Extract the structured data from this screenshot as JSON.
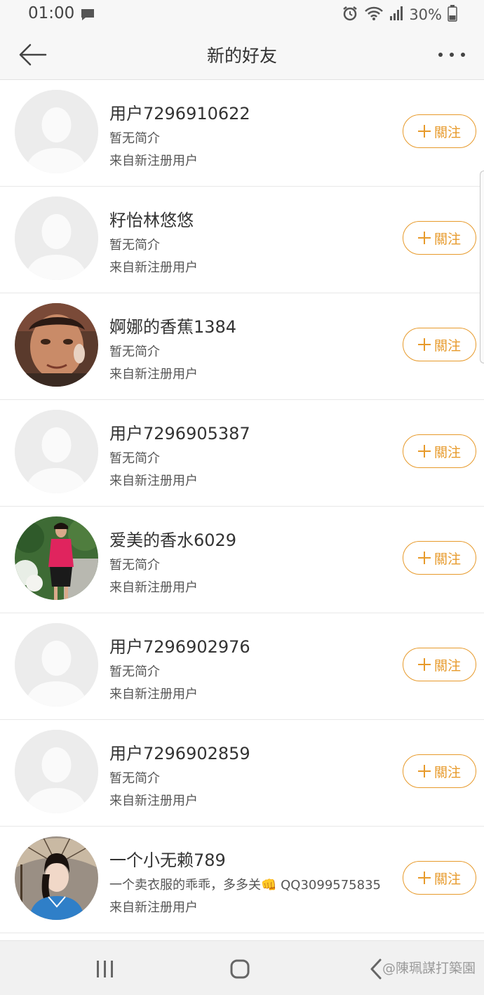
{
  "status_bar": {
    "time": "01:00",
    "battery": "30%",
    "icons": [
      "message-icon",
      "alarm-icon",
      "wifi-icon",
      "signal-icon",
      "battery-icon"
    ]
  },
  "header": {
    "title": "新的好友",
    "back_icon": "back-arrow-icon",
    "more_icon": "more-icon"
  },
  "users": [
    {
      "name": "用户7296910622",
      "bio": "暂无简介",
      "source": "来自新注册用户",
      "follow_label": "關注",
      "avatar": "default-avatar"
    },
    {
      "name": "籽怡林悠悠",
      "bio": "暂无简介",
      "source": "来自新注册用户",
      "follow_label": "關注",
      "avatar": "default-avatar"
    },
    {
      "name": "婀娜的香蕉1384",
      "bio": "暂无简介",
      "source": "来自新注册用户",
      "follow_label": "關注",
      "avatar": "photo-avatar"
    },
    {
      "name": "用户7296905387",
      "bio": "暂无简介",
      "source": "来自新注册用户",
      "follow_label": "關注",
      "avatar": "default-avatar"
    },
    {
      "name": "爱美的香水6029",
      "bio": "暂无简介",
      "source": "来自新注册用户",
      "follow_label": "關注",
      "avatar": "photo-avatar"
    },
    {
      "name": "用户7296902976",
      "bio": "暂无简介",
      "source": "来自新注册用户",
      "follow_label": "關注",
      "avatar": "default-avatar"
    },
    {
      "name": "用户7296902859",
      "bio": "暂无简介",
      "source": "来自新注册用户",
      "follow_label": "關注",
      "avatar": "default-avatar"
    },
    {
      "name": "一个小无赖789",
      "bio": "一个卖衣服的乖乖，多多关👊 QQ3099575835",
      "source": "来自新注册用户",
      "follow_label": "關注",
      "avatar": "photo-avatar"
    }
  ],
  "colors": {
    "accent": "#e79a2b",
    "divider": "#e8e8e8",
    "header_bg": "#f7f7f7"
  },
  "nav_bar": {
    "icons": [
      "recent-apps-icon",
      "home-icon",
      "back-icon"
    ],
    "watermark": "@陳珮謀打築園"
  }
}
